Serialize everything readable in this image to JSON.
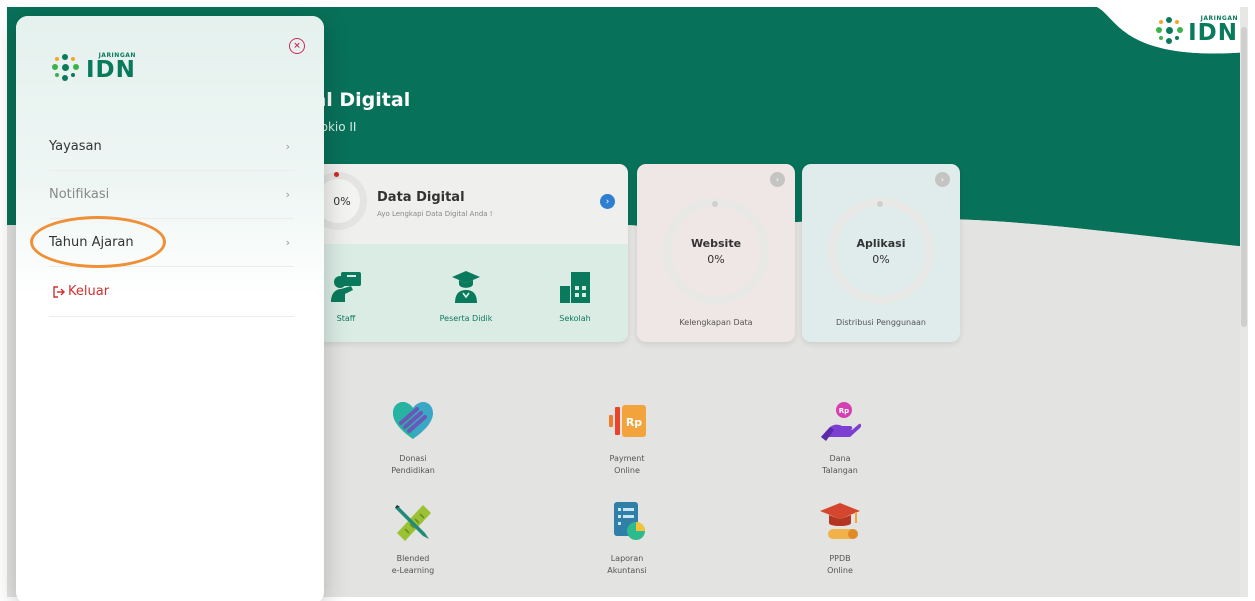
{
  "brand": {
    "tag": "JARINGAN",
    "name": "IDN",
    "colors": {
      "green": "#0a7a5c",
      "teal": "#087159",
      "orange": "#ef8f36",
      "red": "#d23030",
      "blue": "#2f7fd0"
    }
  },
  "header": {
    "title": "rtal Digital",
    "subtitle": "nokio II"
  },
  "data_digital_card": {
    "progress": "0%",
    "title": "Data Digital",
    "subtitle": "Ayo Lengkapi Data Digital Anda !",
    "categories": [
      {
        "label": "Staff",
        "icon": "staff-icon"
      },
      {
        "label": "Peserta Didik",
        "icon": "graduate-icon"
      },
      {
        "label": "Sekolah",
        "icon": "building-icon"
      }
    ]
  },
  "website_card": {
    "title": "Website",
    "value": "0%",
    "footer": "Kelengkapan Data"
  },
  "aplikasi_card": {
    "title": "Aplikasi",
    "value": "0%",
    "footer": "Distribusi Penggunaan"
  },
  "services": [
    {
      "line1": "Donasi",
      "line2": "Pendidikan",
      "icon": "donation-heart-icon"
    },
    {
      "line1": "Payment",
      "line2": "Online",
      "icon": "payment-rp-icon"
    },
    {
      "line1": "Dana",
      "line2": "Talangan",
      "icon": "hand-coin-icon"
    },
    {
      "line1": "Blended",
      "line2": "e-Learning",
      "icon": "ruler-pencil-icon"
    },
    {
      "line1": "Laporan",
      "line2": "Akuntansi",
      "icon": "report-chart-icon"
    },
    {
      "line1": "PPDB",
      "line2": "Online",
      "icon": "graduation-cap-icon"
    }
  ],
  "drawer": {
    "menu": [
      {
        "label": "Yayasan",
        "chevron": "›"
      },
      {
        "label": "Notifikasi",
        "chevron": "›"
      },
      {
        "label": "Tahun Ajaran",
        "chevron": "›"
      }
    ],
    "logout_label": "Keluar",
    "close_symbol": "×"
  }
}
